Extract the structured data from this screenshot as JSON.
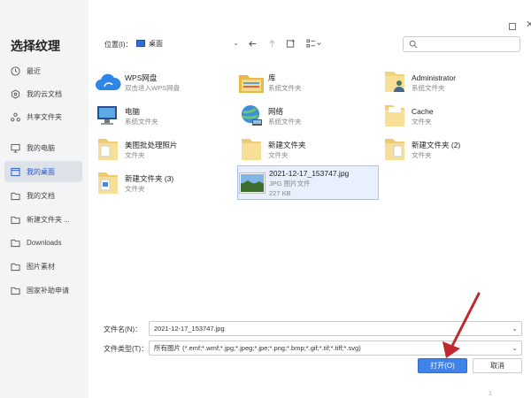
{
  "dialog": {
    "title": "选择纹理"
  },
  "sidebar": {
    "items": [
      {
        "label": "最近",
        "icon": "clock-icon"
      },
      {
        "label": "我的云文档",
        "icon": "cloud-doc-icon"
      },
      {
        "label": "共享文件夹",
        "icon": "share-icon"
      },
      {
        "label": "我的电脑",
        "icon": "computer-icon"
      },
      {
        "label": "我的桌面",
        "icon": "desktop-icon",
        "active": true
      },
      {
        "label": "我的文档",
        "icon": "folder-icon"
      },
      {
        "label": "新建文件夹 ...",
        "icon": "folder-icon"
      },
      {
        "label": "Downloads",
        "icon": "folder-icon"
      },
      {
        "label": "图片素材",
        "icon": "folder-icon"
      },
      {
        "label": "国家补助申请",
        "icon": "folder-icon"
      }
    ]
  },
  "toolbar": {
    "location_label": "位置(I)：",
    "location_value": "桌面",
    "search_placeholder": ""
  },
  "files": [
    {
      "name": "WPS网盘",
      "sub": "双击进入WPS网盘",
      "icon": "cloud-drive-icon"
    },
    {
      "name": "库",
      "sub": "系统文件夹",
      "icon": "library-icon"
    },
    {
      "name": "Administrator",
      "sub": "系统文件夹",
      "icon": "user-folder-icon"
    },
    {
      "name": "电脑",
      "sub": "系统文件夹",
      "icon": "computer-icon"
    },
    {
      "name": "网络",
      "sub": "系统文件夹",
      "icon": "network-icon"
    },
    {
      "name": "Cache",
      "sub": "文件夹",
      "icon": "folder-icon"
    },
    {
      "name": "美图批处理照片",
      "sub": "文件夹",
      "icon": "folder-icon"
    },
    {
      "name": "新建文件夹",
      "sub": "文件夹",
      "icon": "folder-icon"
    },
    {
      "name": "新建文件夹 (2)",
      "sub": "文件夹",
      "icon": "folder-icon"
    },
    {
      "name": "新建文件夹 (3)",
      "sub": "文件夹",
      "icon": "folder-icon"
    },
    {
      "name": "2021-12-17_153747.jpg",
      "sub": "JPG 图片文件",
      "sub2": "227 KB",
      "icon": "image-thumbnail-icon",
      "selected": true
    }
  ],
  "form": {
    "filename_label": "文件名(N)：",
    "filename_value": "2021-12-17_153747.jpg",
    "filetype_label": "文件类型(T)：",
    "filetype_value": "所有图片 (*.emf;*.wmf;*.jpg;*.jpeg;*.jpe;*.png;*.bmp;*.gif;*.tif;*.tiff;*.svg)"
  },
  "buttons": {
    "open": "打开(O)",
    "cancel": "取消"
  },
  "footer": {
    "page_number": "1"
  },
  "colors": {
    "accent": "#3f82e8",
    "sidebar_bg": "#f3f4f6",
    "selected_bg": "#e7f0fc",
    "arrow": "#c0282d"
  }
}
